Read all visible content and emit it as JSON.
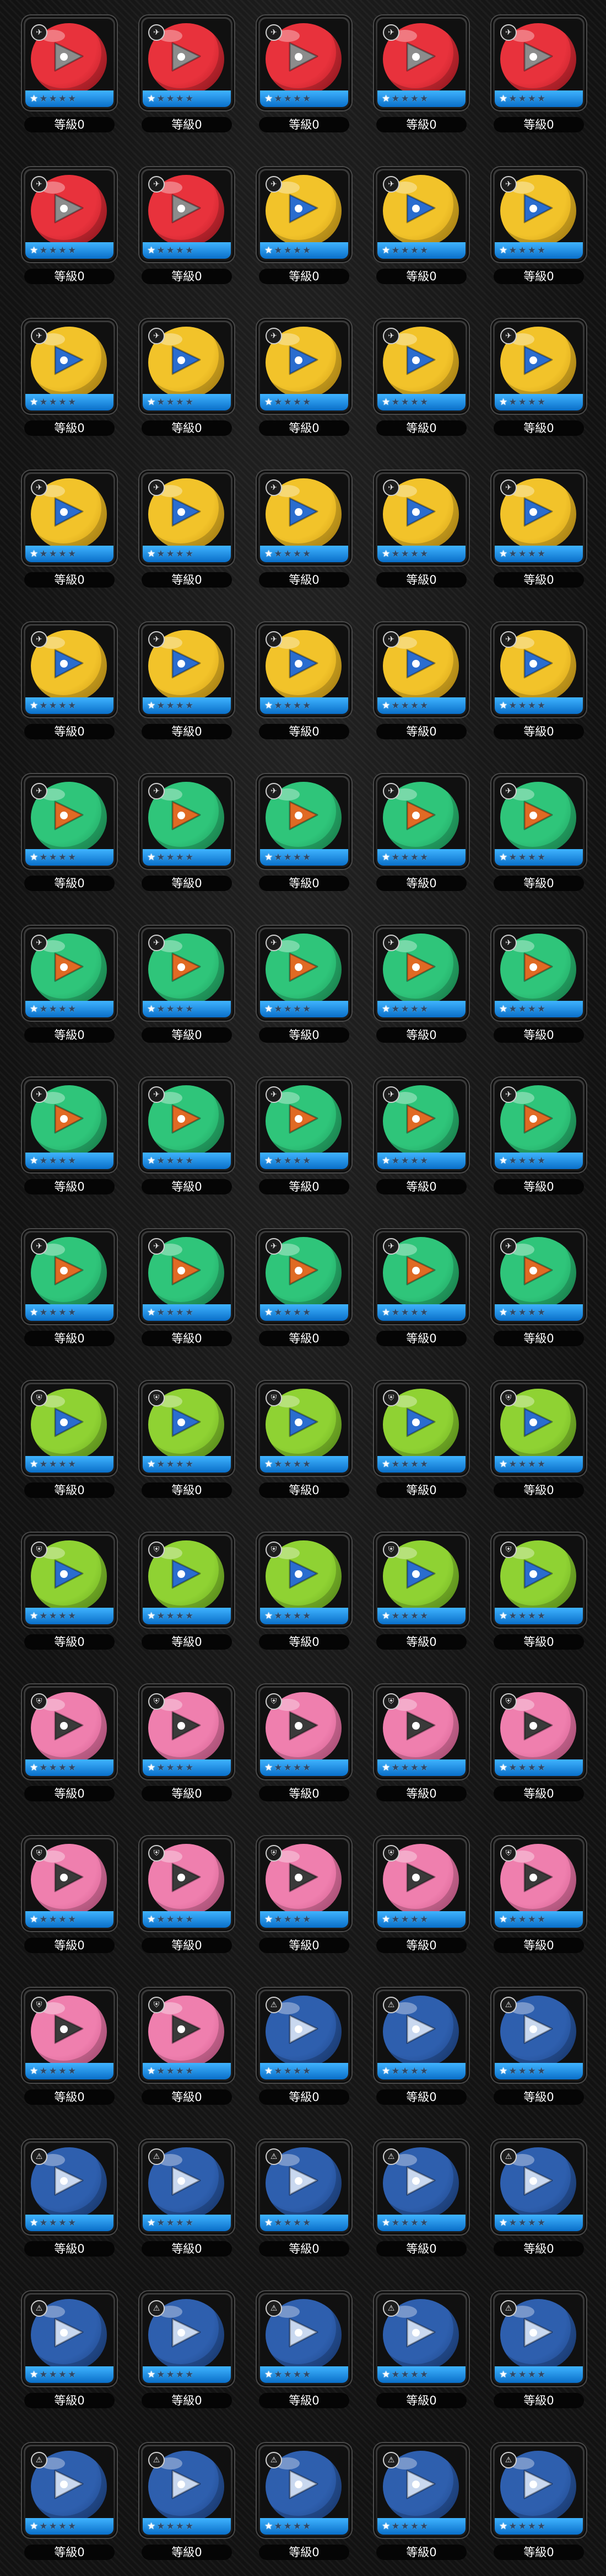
{
  "level_label": "等級0",
  "variants": {
    "red": {
      "body": "#e8323c",
      "dark": "#a3131d",
      "emblem": "#8c8c8c",
      "icon": "balloon-icon",
      "glyph": "✈"
    },
    "yellow": {
      "body": "#f2c32a",
      "dark": "#c08a0c",
      "emblem": "#2a6dcf",
      "icon": "balloon-icon",
      "glyph": "✈"
    },
    "green": {
      "body": "#2fc57a",
      "dark": "#168a50",
      "emblem": "#e06a24",
      "icon": "balloon-icon",
      "glyph": "✈"
    },
    "lime": {
      "body": "#8fd233",
      "dark": "#5c9a17",
      "emblem": "#2a6dcf",
      "icon": "shield-icon",
      "glyph": "⛨"
    },
    "pink": {
      "body": "#ef7fae",
      "dark": "#c24d80",
      "emblem": "#3a3a3a",
      "icon": "shield-icon",
      "glyph": "⛨"
    },
    "blue": {
      "body": "#2e5fae",
      "dark": "#173a78",
      "emblem": "#c9d8ef",
      "icon": "triangle-icon",
      "glyph": "⚠"
    }
  },
  "items": [
    {
      "variant": "red",
      "stars": 1,
      "level": "等級0"
    },
    {
      "variant": "red",
      "stars": 1,
      "level": "等級0"
    },
    {
      "variant": "red",
      "stars": 1,
      "level": "等級0"
    },
    {
      "variant": "red",
      "stars": 1,
      "level": "等級0"
    },
    {
      "variant": "red",
      "stars": 1,
      "level": "等級0"
    },
    {
      "variant": "red",
      "stars": 1,
      "level": "等級0"
    },
    {
      "variant": "red",
      "stars": 1,
      "level": "等級0"
    },
    {
      "variant": "yellow",
      "stars": 1,
      "level": "等級0"
    },
    {
      "variant": "yellow",
      "stars": 1,
      "level": "等級0"
    },
    {
      "variant": "yellow",
      "stars": 1,
      "level": "等級0"
    },
    {
      "variant": "yellow",
      "stars": 1,
      "level": "等級0"
    },
    {
      "variant": "yellow",
      "stars": 1,
      "level": "等級0"
    },
    {
      "variant": "yellow",
      "stars": 1,
      "level": "等級0"
    },
    {
      "variant": "yellow",
      "stars": 1,
      "level": "等級0"
    },
    {
      "variant": "yellow",
      "stars": 1,
      "level": "等級0"
    },
    {
      "variant": "yellow",
      "stars": 1,
      "level": "等級0"
    },
    {
      "variant": "yellow",
      "stars": 1,
      "level": "等級0"
    },
    {
      "variant": "yellow",
      "stars": 1,
      "level": "等級0"
    },
    {
      "variant": "yellow",
      "stars": 1,
      "level": "等級0"
    },
    {
      "variant": "yellow",
      "stars": 1,
      "level": "等級0"
    },
    {
      "variant": "yellow",
      "stars": 1,
      "level": "等級0"
    },
    {
      "variant": "yellow",
      "stars": 1,
      "level": "等級0"
    },
    {
      "variant": "yellow",
      "stars": 1,
      "level": "等級0"
    },
    {
      "variant": "yellow",
      "stars": 1,
      "level": "等級0"
    },
    {
      "variant": "yellow",
      "stars": 1,
      "level": "等級0"
    },
    {
      "variant": "green",
      "stars": 1,
      "level": "等級0"
    },
    {
      "variant": "green",
      "stars": 1,
      "level": "等級0"
    },
    {
      "variant": "green",
      "stars": 1,
      "level": "等級0"
    },
    {
      "variant": "green",
      "stars": 1,
      "level": "等級0"
    },
    {
      "variant": "green",
      "stars": 1,
      "level": "等級0"
    },
    {
      "variant": "green",
      "stars": 1,
      "level": "等級0"
    },
    {
      "variant": "green",
      "stars": 1,
      "level": "等級0"
    },
    {
      "variant": "green",
      "stars": 1,
      "level": "等級0"
    },
    {
      "variant": "green",
      "stars": 1,
      "level": "等級0"
    },
    {
      "variant": "green",
      "stars": 1,
      "level": "等級0"
    },
    {
      "variant": "green",
      "stars": 1,
      "level": "等級0"
    },
    {
      "variant": "green",
      "stars": 1,
      "level": "等級0"
    },
    {
      "variant": "green",
      "stars": 1,
      "level": "等級0"
    },
    {
      "variant": "green",
      "stars": 1,
      "level": "等級0"
    },
    {
      "variant": "green",
      "stars": 1,
      "level": "等級0"
    },
    {
      "variant": "green",
      "stars": 1,
      "level": "等級0"
    },
    {
      "variant": "green",
      "stars": 1,
      "level": "等級0"
    },
    {
      "variant": "green",
      "stars": 1,
      "level": "等級0"
    },
    {
      "variant": "green",
      "stars": 1,
      "level": "等級0"
    },
    {
      "variant": "green",
      "stars": 1,
      "level": "等級0"
    },
    {
      "variant": "lime",
      "stars": 1,
      "level": "等級0"
    },
    {
      "variant": "lime",
      "stars": 1,
      "level": "等級0"
    },
    {
      "variant": "lime",
      "stars": 1,
      "level": "等級0"
    },
    {
      "variant": "lime",
      "stars": 1,
      "level": "等級0"
    },
    {
      "variant": "lime",
      "stars": 1,
      "level": "等級0"
    },
    {
      "variant": "lime",
      "stars": 1,
      "level": "等級0"
    },
    {
      "variant": "lime",
      "stars": 1,
      "level": "等級0"
    },
    {
      "variant": "lime",
      "stars": 1,
      "level": "等級0"
    },
    {
      "variant": "lime",
      "stars": 1,
      "level": "等級0"
    },
    {
      "variant": "lime",
      "stars": 1,
      "level": "等級0"
    },
    {
      "variant": "pink",
      "stars": 1,
      "level": "等級0"
    },
    {
      "variant": "pink",
      "stars": 1,
      "level": "等級0"
    },
    {
      "variant": "pink",
      "stars": 1,
      "level": "等級0"
    },
    {
      "variant": "pink",
      "stars": 1,
      "level": "等級0"
    },
    {
      "variant": "pink",
      "stars": 1,
      "level": "等級0"
    },
    {
      "variant": "pink",
      "stars": 1,
      "level": "等級0"
    },
    {
      "variant": "pink",
      "stars": 1,
      "level": "等級0"
    },
    {
      "variant": "pink",
      "stars": 1,
      "level": "等級0"
    },
    {
      "variant": "pink",
      "stars": 1,
      "level": "等級0"
    },
    {
      "variant": "pink",
      "stars": 1,
      "level": "等級0"
    },
    {
      "variant": "pink",
      "stars": 1,
      "level": "等級0"
    },
    {
      "variant": "pink",
      "stars": 1,
      "level": "等級0"
    },
    {
      "variant": "blue",
      "stars": 1,
      "level": "等級0"
    },
    {
      "variant": "blue",
      "stars": 1,
      "level": "等級0"
    },
    {
      "variant": "blue",
      "stars": 1,
      "level": "等級0"
    },
    {
      "variant": "blue",
      "stars": 1,
      "level": "等級0"
    },
    {
      "variant": "blue",
      "stars": 1,
      "level": "等級0"
    },
    {
      "variant": "blue",
      "stars": 1,
      "level": "等級0"
    },
    {
      "variant": "blue",
      "stars": 1,
      "level": "等級0"
    },
    {
      "variant": "blue",
      "stars": 1,
      "level": "等級0"
    },
    {
      "variant": "blue",
      "stars": 1,
      "level": "等級0"
    },
    {
      "variant": "blue",
      "stars": 1,
      "level": "等級0"
    },
    {
      "variant": "blue",
      "stars": 1,
      "level": "等級0"
    },
    {
      "variant": "blue",
      "stars": 1,
      "level": "等級0"
    },
    {
      "variant": "blue",
      "stars": 1,
      "level": "等級0"
    },
    {
      "variant": "blue",
      "stars": 1,
      "level": "等級0"
    },
    {
      "variant": "blue",
      "stars": 1,
      "level": "等級0"
    },
    {
      "variant": "blue",
      "stars": 1,
      "level": "等級0"
    },
    {
      "variant": "blue",
      "stars": 1,
      "level": "等級0"
    },
    {
      "variant": "blue",
      "stars": 1,
      "level": "等級0"
    }
  ],
  "max_stars": 5
}
